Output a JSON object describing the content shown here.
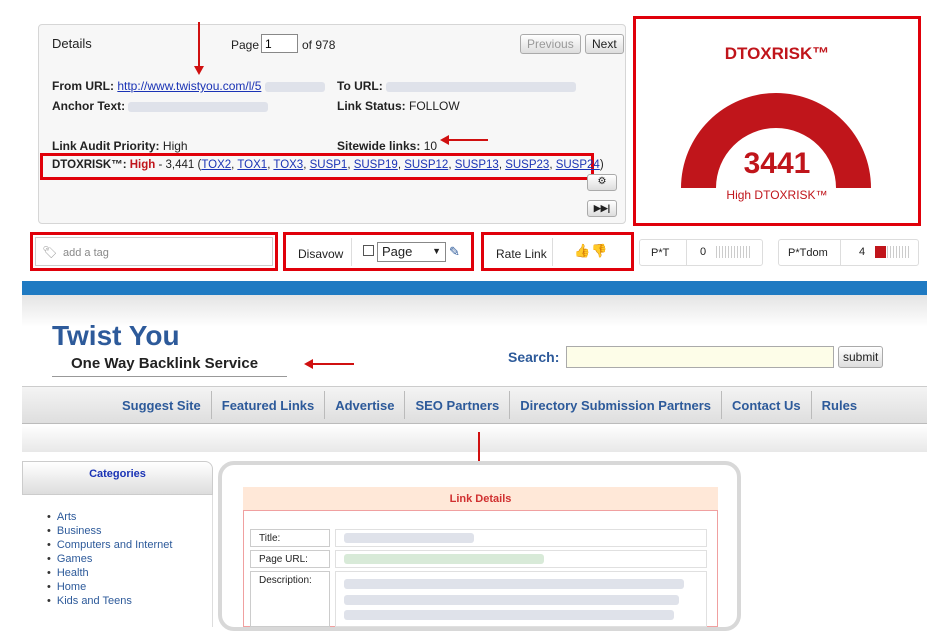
{
  "details": {
    "title": "Details",
    "page_label": "Page",
    "page_value": "1",
    "page_of": "of 978",
    "prev_label": "Previous",
    "next_label": "Next",
    "from_url_label": "From URL:",
    "from_url_value": "http://www.twistyou.com/l/5",
    "to_url_label": "To URL:",
    "anchor_text_label": "Anchor Text:",
    "link_status_label": "Link Status:",
    "link_status_value": "FOLLOW",
    "audit_priority_label": "Link Audit Priority:",
    "audit_priority_value": "High",
    "sitewide_label": "Sitewide links:",
    "sitewide_value": "10",
    "dtoxrisk_label": "DTOXRISK™:",
    "dtoxrisk_level": "High",
    "dtoxrisk_value": " - 3,441 (",
    "dtoxrisk_close": ")",
    "rules": [
      "TOX2",
      "TOX1",
      "TOX3",
      "SUSP1",
      "SUSP19",
      "SUSP12",
      "SUSP13",
      "SUSP23",
      "SUSP24"
    ]
  },
  "gauge": {
    "title": "DTOXRISK™",
    "value": "3441",
    "caption": "High DTOXRISK™",
    "color": "#c0151b"
  },
  "toolbar": {
    "tag_placeholder": "add a tag",
    "disavow_label": "Disavow",
    "disavow_select": "Page",
    "rate_label": "Rate Link",
    "pt_label": "P*T",
    "pt_value": "0",
    "ptdom_label": "P*Tdom",
    "ptdom_value": "4"
  },
  "site": {
    "logo": "Twist You",
    "tagline": "One Way Backlink Service",
    "search_label": "Search:",
    "submit_label": "submit",
    "nav": [
      "Suggest Site",
      "Featured Links",
      "Advertise",
      "SEO Partners",
      "Directory Submission Partners",
      "Contact Us",
      "Rules"
    ],
    "categories_title": "Categories",
    "categories": [
      "Arts",
      "Business",
      "Computers and Internet",
      "Games",
      "Health",
      "Home",
      "Kids and Teens"
    ],
    "link_details_title": "Link Details",
    "fields": [
      "Title:",
      "Page URL:",
      "Description:"
    ]
  }
}
